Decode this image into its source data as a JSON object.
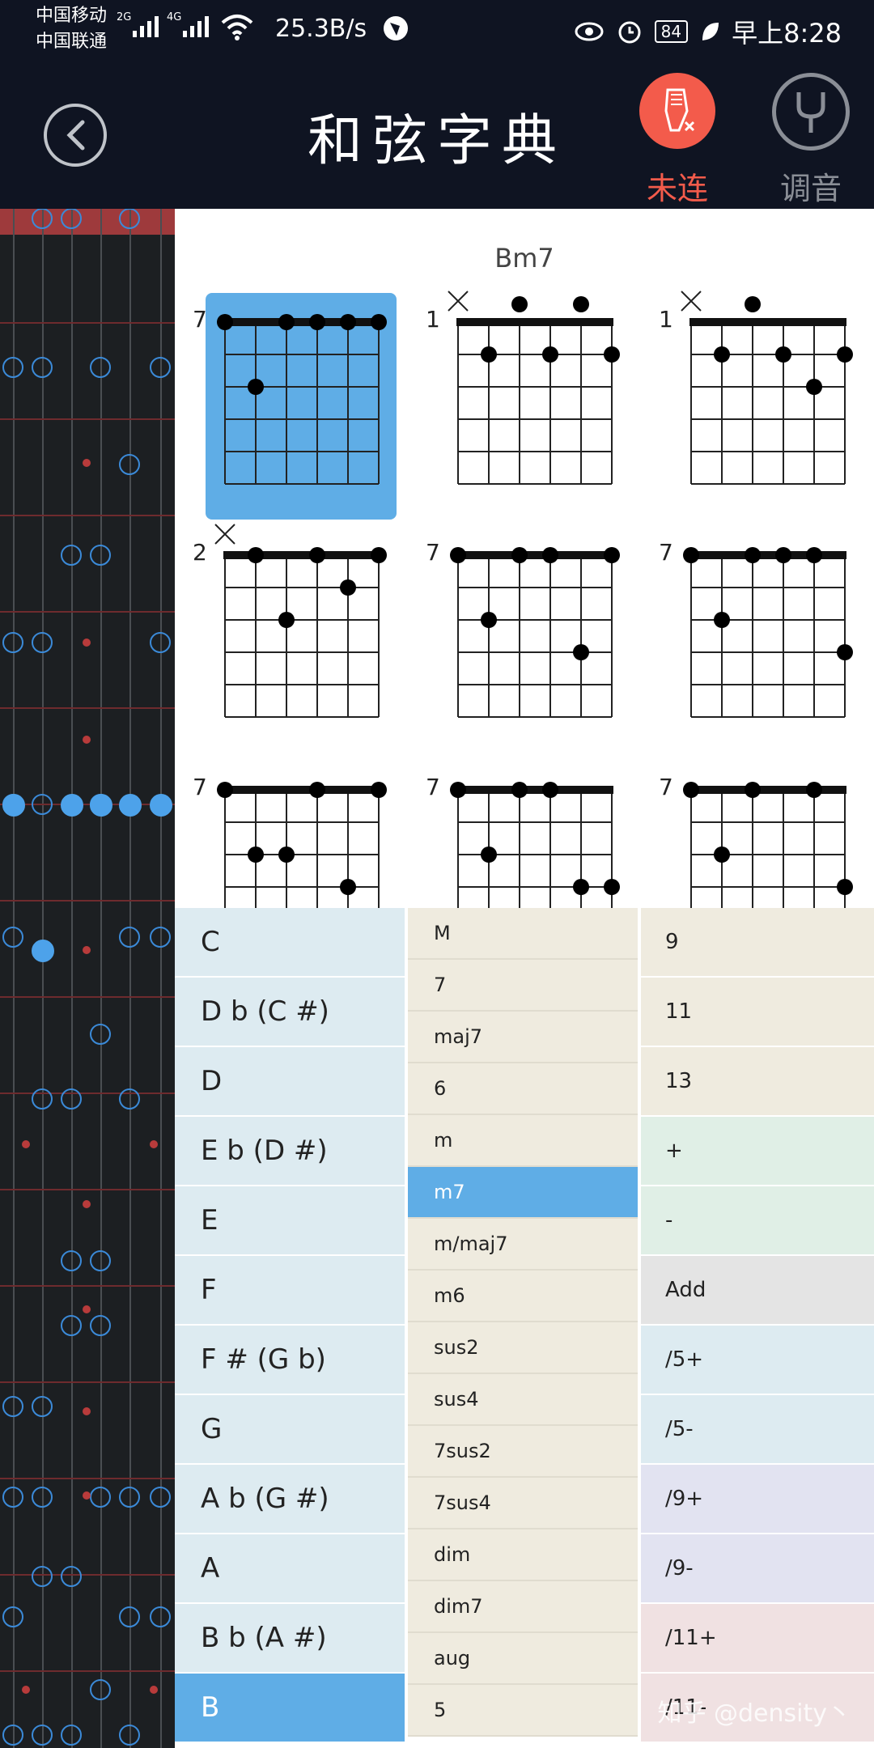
{
  "status_bar": {
    "carrier_1": "中国移动",
    "carrier_2": "中国联通",
    "net_1": "2G",
    "net_2": "4G",
    "speed": "25.3B/s",
    "battery": "84",
    "time": "早上8:28",
    "icons": [
      "signal-icon",
      "wifi-icon",
      "browser-icon",
      "eye-icon",
      "alarm-icon",
      "battery-icon",
      "leaf-icon"
    ]
  },
  "header": {
    "title": "和弦字典",
    "connect_label": "未连",
    "tuner_label": "调音",
    "colors": {
      "background": "#0f1422",
      "connect": "#f35b4b",
      "tuner": "#8a8e96"
    }
  },
  "chord": {
    "name": "Bm7",
    "diagrams": [
      {
        "fret": "7",
        "selected": true
      },
      {
        "fret": "1"
      },
      {
        "fret": "1"
      },
      {
        "fret": "2"
      },
      {
        "fret": "7"
      },
      {
        "fret": "7"
      },
      {
        "fret": "7"
      },
      {
        "fret": "7"
      },
      {
        "fret": "7"
      }
    ]
  },
  "roots": [
    "C",
    "D b (C #)",
    "D",
    "E b (D #)",
    "E",
    "F",
    "F # (G b)",
    "G",
    "A b (G #)",
    "A",
    "B b (A #)",
    "B"
  ],
  "roots_selected": "B",
  "qualities": [
    "M",
    "7",
    "maj7",
    "6",
    "m",
    "m7",
    "m/maj7",
    "m6",
    "sus2",
    "sus4",
    "7sus2",
    "7sus4",
    "dim",
    "dim7",
    "aug",
    "5"
  ],
  "qualities_selected": "m7",
  "extensions": [
    "9",
    "11",
    "13",
    "+",
    "-",
    "Add",
    "/5+",
    "/5-",
    "/9+",
    "/9-",
    "/11+",
    "/11-"
  ],
  "extension_colors": [
    "#efebdf",
    "#efebdf",
    "#efebdf",
    "#e0efe6",
    "#e0efe6",
    "#e4e4e4",
    "#ddebf1",
    "#ddebf1",
    "#e2e3f1",
    "#e2e3f1",
    "#f0e1e2",
    "#f0e1e2"
  ],
  "selected_color": "#5fade6",
  "watermark": "知乎 @density丶"
}
